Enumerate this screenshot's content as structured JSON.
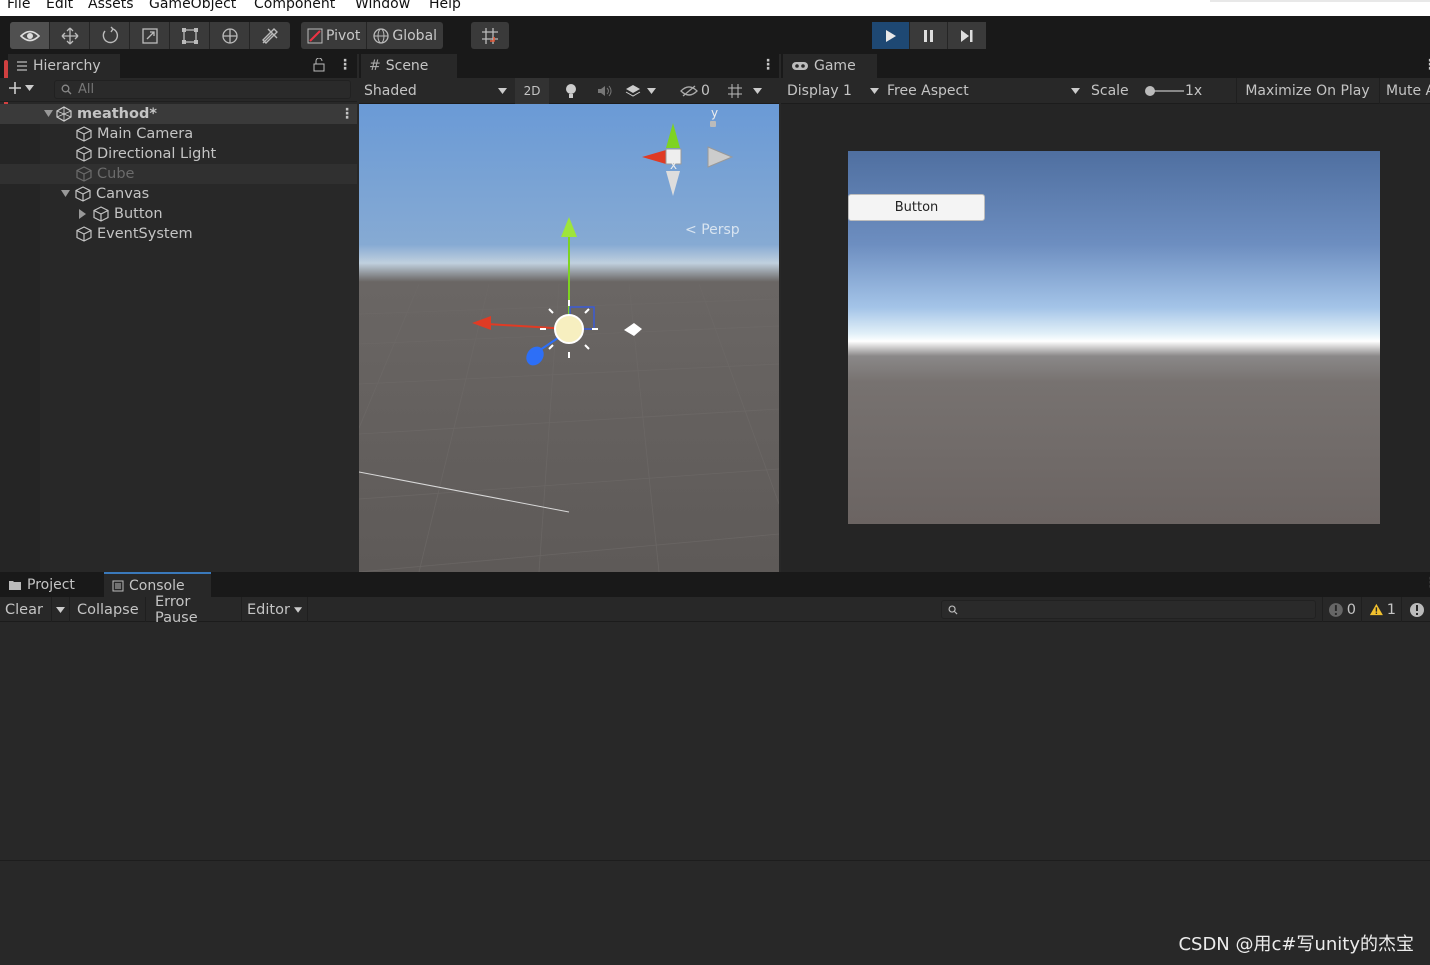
{
  "menu": [
    "File",
    "Edit",
    "Assets",
    "GameObject",
    "Component",
    "Window",
    "Help"
  ],
  "toolbar": {
    "pivot_label": "Pivot",
    "global_label": "Global"
  },
  "hierarchy": {
    "tab_label": "Hierarchy",
    "search_placeholder": "All",
    "scene_name": "meathod*",
    "items": [
      {
        "label": "Main Camera"
      },
      {
        "label": "Directional Light"
      },
      {
        "label": "Cube"
      },
      {
        "label": "Canvas"
      },
      {
        "label": "Button"
      },
      {
        "label": "EventSystem"
      }
    ]
  },
  "scene": {
    "tab_label": "Scene",
    "shading_mode": "Shaded",
    "mode_2d": "2D",
    "hidden_count": "0",
    "gizmo_y": "y",
    "gizmo_x": "x",
    "projection": "Persp"
  },
  "game": {
    "tab_label": "Game",
    "display": "Display 1",
    "aspect": "Free Aspect",
    "scale_label": "Scale",
    "scale_value": "1x",
    "maximize_label": "Maximize On Play",
    "mute_label": "Mute A",
    "ui_button_text": "Button"
  },
  "bottom": {
    "tabs": [
      {
        "label": "Project"
      },
      {
        "label": "Console"
      }
    ],
    "clear_label": "Clear",
    "collapse_label": "Collapse",
    "error_pause_label": "Error Pause",
    "editor_label": "Editor",
    "log_count": "0",
    "warning_count": "1"
  },
  "watermark": "CSDN @用c#写unity的杰宝",
  "colors": {
    "play_active": "#1e4873",
    "panel_bg": "#282828",
    "warning": "#f2c12e"
  }
}
